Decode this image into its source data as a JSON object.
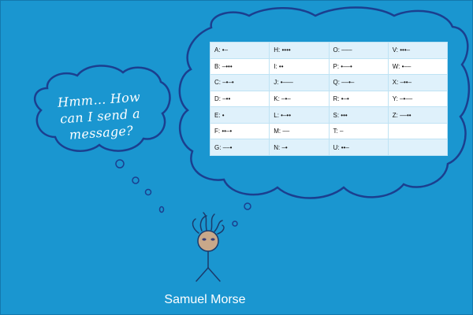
{
  "small_thought": {
    "lines": [
      "Hmm… How",
      "can I send a",
      "message?"
    ]
  },
  "morse_table": {
    "rows": [
      [
        "A: •–",
        "H: ••••",
        "O: –––",
        "V: •••–"
      ],
      [
        "B: –•••",
        "I: ••",
        "P: •––•",
        "W: •––"
      ],
      [
        "C: –•–•",
        "J: •–––",
        "Q: ––•–",
        "X: –••–"
      ],
      [
        "D: –••",
        "K: –•–",
        "R: •–•",
        "Y: –•––"
      ],
      [
        "E: •",
        "L: •–••",
        "S: •••",
        "Z: ––••"
      ],
      [
        "F: ••–•",
        "M: ––",
        "T: –",
        ""
      ],
      [
        "G: ––•",
        "N: –•",
        "U: ••–",
        ""
      ]
    ]
  },
  "person": {
    "name": "Samuel Morse"
  },
  "colors": {
    "background": "#1a96d0",
    "outline": "#1b3f8f",
    "table_stripe": "#dff1fb",
    "skin": "#c8a88a"
  }
}
